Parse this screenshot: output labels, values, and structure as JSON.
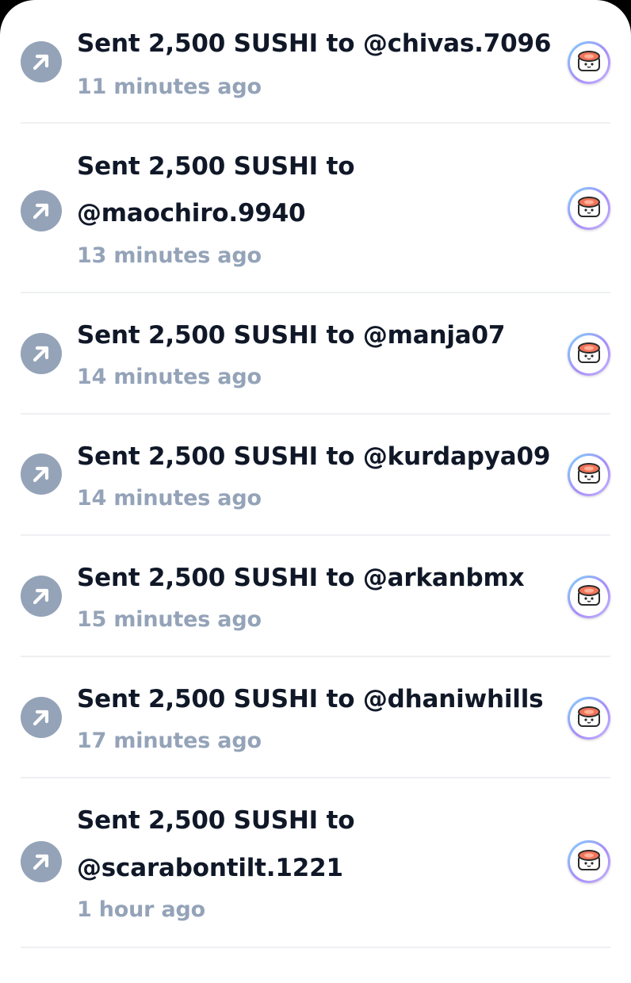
{
  "activity": {
    "items": [
      {
        "title_line1": "Sent 2,500 SUSHI to @chivas.7096",
        "title_line2": "",
        "time": "11 minutes ago",
        "icon": "arrow-up-right-icon",
        "avatar": "sushi-token-icon"
      },
      {
        "title_line1": "Sent 2,500 SUSHI to",
        "title_line2": "@maochiro.9940",
        "time": "13 minutes ago",
        "icon": "arrow-up-right-icon",
        "avatar": "sushi-token-icon"
      },
      {
        "title_line1": "Sent 2,500 SUSHI to @manja07",
        "title_line2": "",
        "time": "14 minutes ago",
        "icon": "arrow-up-right-icon",
        "avatar": "sushi-token-icon"
      },
      {
        "title_line1": "Sent 2,500 SUSHI to @kurdapya09",
        "title_line2": "",
        "time": "14 minutes ago",
        "icon": "arrow-up-right-icon",
        "avatar": "sushi-token-icon"
      },
      {
        "title_line1": "Sent 2,500 SUSHI to @arkanbmx",
        "title_line2": "",
        "time": "15 minutes ago",
        "icon": "arrow-up-right-icon",
        "avatar": "sushi-token-icon"
      },
      {
        "title_line1": "Sent 2,500 SUSHI to @dhaniwhills",
        "title_line2": "",
        "time": "17 minutes ago",
        "icon": "arrow-up-right-icon",
        "avatar": "sushi-token-icon"
      },
      {
        "title_line1": "Sent 2,500 SUSHI to",
        "title_line2": "@scarabontilt.1221",
        "time": "1 hour ago",
        "icon": "arrow-up-right-icon",
        "avatar": "sushi-token-icon"
      }
    ]
  },
  "colors": {
    "title": "#101828",
    "subtitle": "#94a3b8",
    "send_icon_bg": "#94a3b8",
    "divider": "#eef0f3"
  }
}
